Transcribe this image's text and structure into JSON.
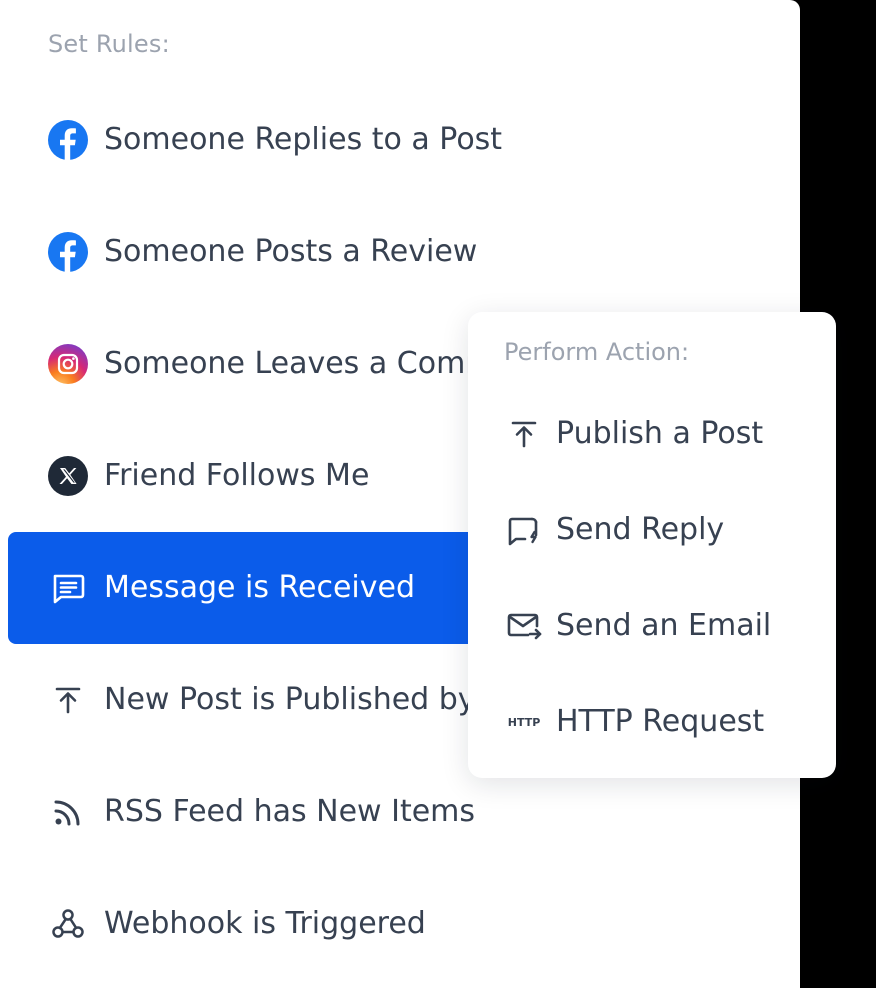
{
  "rules": {
    "title": "Set Rules:",
    "items": [
      {
        "label": "Someone Replies to a Post",
        "icon": "facebook-icon"
      },
      {
        "label": "Someone Posts a Review",
        "icon": "facebook-icon"
      },
      {
        "label": "Someone Leaves a Comment",
        "icon": "instagram-icon"
      },
      {
        "label": "Friend Follows Me",
        "icon": "x-logo-icon"
      },
      {
        "label": "Message is Received",
        "icon": "message-icon",
        "selected": true
      },
      {
        "label": "New Post is Published by",
        "icon": "upload-icon"
      },
      {
        "label": "RSS Feed has New Items",
        "icon": "rss-icon"
      },
      {
        "label": "Webhook is Triggered",
        "icon": "webhook-icon"
      }
    ]
  },
  "actions": {
    "title": "Perform Action:",
    "items": [
      {
        "label": "Publish a Post",
        "icon": "upload-icon"
      },
      {
        "label": "Send Reply",
        "icon": "reply-icon"
      },
      {
        "label": "Send an Email",
        "icon": "email-send-icon"
      },
      {
        "label": "HTTP Request",
        "icon": "http-icon",
        "icon_text": "HTTP"
      }
    ]
  },
  "colors": {
    "selected_bg": "#0b5cea",
    "facebook": "#1877f2",
    "text": "#374151",
    "muted": "#9ca3af"
  }
}
